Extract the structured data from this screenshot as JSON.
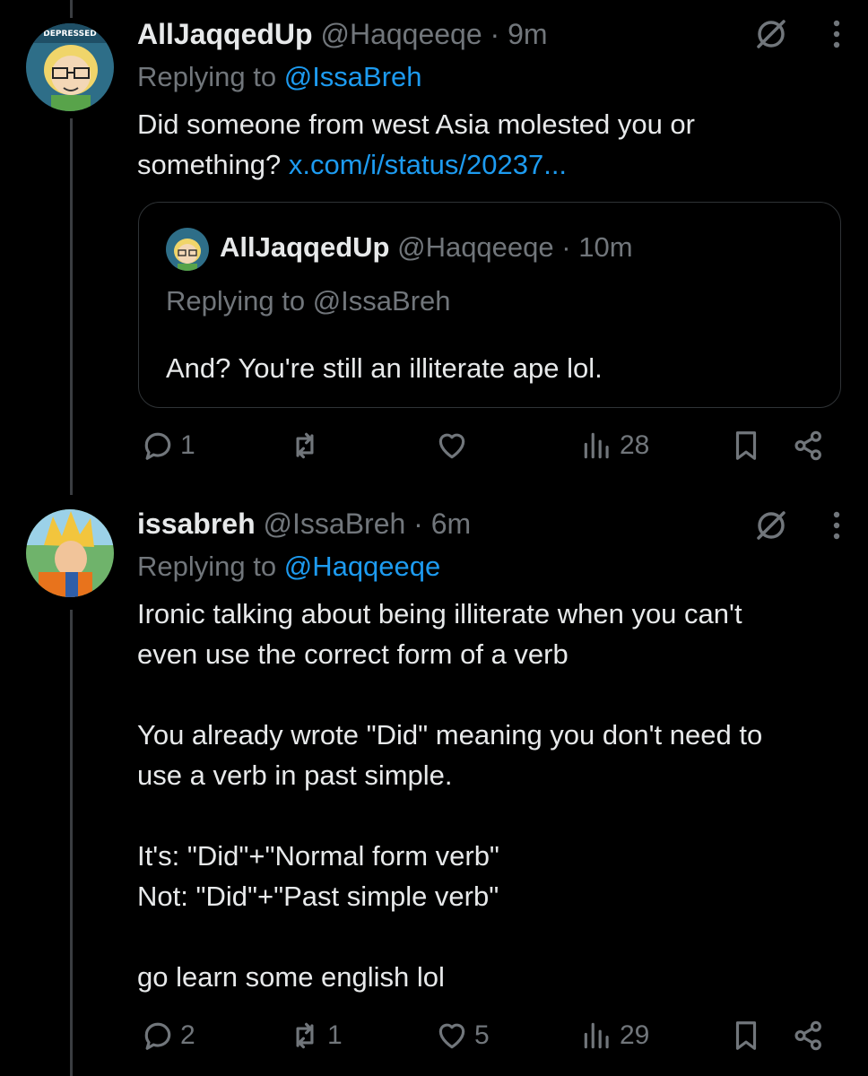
{
  "tweets": [
    {
      "name": "AllJaqqedUp",
      "handle": "@Haqqeeqe",
      "dot": "·",
      "time": "9m",
      "replying_prefix": "Replying to ",
      "replying_to": "@IssaBreh",
      "text": "Did someone from west Asia molested you or\nsomething? ",
      "link": "x.com/i/status/20237...",
      "quote": {
        "name": "AllJaqqedUp",
        "handle": "@Haqqeeqe",
        "dot": "·",
        "time": "10m",
        "replying": "Replying to @IssaBreh",
        "text": "And? You're still an illiterate ape lol."
      },
      "actions": {
        "replies": "1",
        "retweets": "",
        "likes": "",
        "views": "28"
      }
    },
    {
      "name": "issabreh",
      "handle": "@IssaBreh",
      "dot": "·",
      "time": "6m",
      "replying_prefix": "Replying to ",
      "replying_to": "@Haqqeeqe",
      "text": "Ironic talking about being illiterate when you can't\neven use the correct form of a verb\n\nYou already wrote \"Did\" meaning you don't need to\nuse a verb in past simple.\n\nIt's: \"Did\"+\"Normal form verb\"\nNot: \"Did\"+\"Past simple verb\"\n\ngo learn some english lol",
      "actions": {
        "replies": "2",
        "retweets": "1",
        "likes": "5",
        "views": "29"
      }
    }
  ],
  "icons": {
    "grok": "grok-icon",
    "more": "more-icon",
    "reply": "reply-icon",
    "retweet": "retweet-icon",
    "like": "like-icon",
    "views": "views-icon",
    "bookmark": "bookmark-icon",
    "share": "share-icon"
  },
  "colors": {
    "background": "#000000",
    "text": "#e7e9ea",
    "muted": "#71767b",
    "link": "#1d9bf0",
    "border": "#2f3336"
  }
}
